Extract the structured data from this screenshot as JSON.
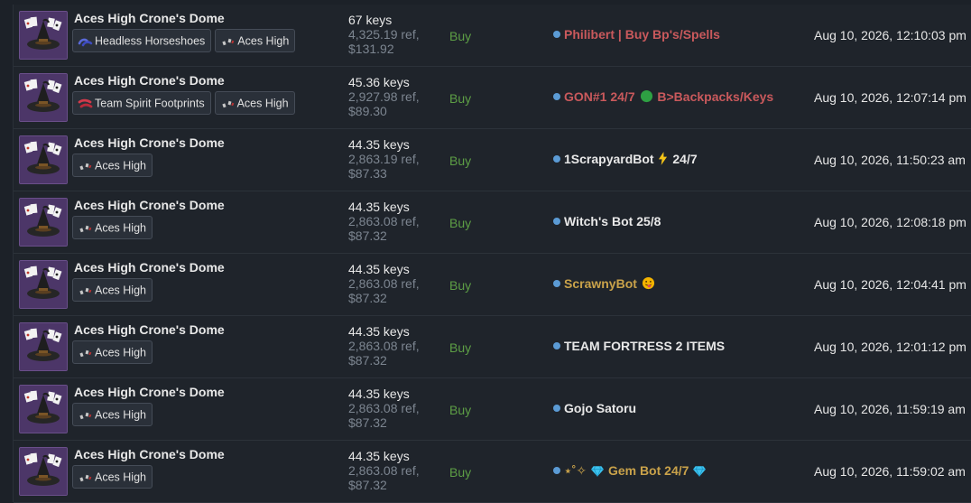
{
  "listings": [
    {
      "item": "Aces High Crone's Dome",
      "tags": [
        {
          "icon": "headless-horseshoes-icon",
          "label": "Headless Horseshoes"
        },
        {
          "icon": "aces-high-icon",
          "label": "Aces High"
        }
      ],
      "keys": "67 keys",
      "ref": "4,325.19 ref,",
      "usd": "$131.92",
      "intent": "Buy",
      "seller": {
        "pre": "Philibert | Buy Bp's/Spells",
        "emoji": "",
        "post": "",
        "color": "#c9595c"
      },
      "time": "Aug 10, 2026, 12:10:03 pm"
    },
    {
      "item": "Aces High Crone's Dome",
      "tags": [
        {
          "icon": "team-spirit-footprints-icon",
          "label": "Team Spirit Footprints"
        },
        {
          "icon": "aces-high-icon",
          "label": "Aces High"
        }
      ],
      "keys": "45.36 keys",
      "ref": "2,927.98 ref,",
      "usd": "$89.30",
      "intent": "Buy",
      "seller": {
        "pre": "GON#1 24/7",
        "emoji": "green-circle-icon",
        "post": "B>Backpacks/Keys",
        "color": "#c9595c"
      },
      "time": "Aug 10, 2026, 12:07:14 pm"
    },
    {
      "item": "Aces High Crone's Dome",
      "tags": [
        {
          "icon": "aces-high-icon",
          "label": "Aces High"
        }
      ],
      "keys": "44.35 keys",
      "ref": "2,863.19 ref,",
      "usd": "$87.33",
      "intent": "Buy",
      "seller": {
        "pre": "1ScrapyardBot",
        "emoji": "lightning-icon",
        "post": "24/7",
        "color": "#e8e8e8"
      },
      "time": "Aug 10, 2026, 11:50:23 am"
    },
    {
      "item": "Aces High Crone's Dome",
      "tags": [
        {
          "icon": "aces-high-icon",
          "label": "Aces High"
        }
      ],
      "keys": "44.35 keys",
      "ref": "2,863.08 ref,",
      "usd": "$87.32",
      "intent": "Buy",
      "seller": {
        "pre": "Witch's Bot 25/8",
        "emoji": "",
        "post": "",
        "color": "#e8e8e8"
      },
      "time": "Aug 10, 2026, 12:08:18 pm"
    },
    {
      "item": "Aces High Crone's Dome",
      "tags": [
        {
          "icon": "aces-high-icon",
          "label": "Aces High"
        }
      ],
      "keys": "44.35 keys",
      "ref": "2,863.08 ref,",
      "usd": "$87.32",
      "intent": "Buy",
      "seller": {
        "pre": "ScrawnyBot",
        "emoji": "tongue-face-icon",
        "post": "",
        "color": "#c9a24a"
      },
      "time": "Aug 10, 2026, 12:04:41 pm"
    },
    {
      "item": "Aces High Crone's Dome",
      "tags": [
        {
          "icon": "aces-high-icon",
          "label": "Aces High"
        }
      ],
      "keys": "44.35 keys",
      "ref": "2,863.08 ref,",
      "usd": "$87.32",
      "intent": "Buy",
      "seller": {
        "pre": "TEAM FORTRESS 2 ITEMS",
        "emoji": "",
        "post": "",
        "color": "#e8e8e8"
      },
      "time": "Aug 10, 2026, 12:01:12 pm"
    },
    {
      "item": "Aces High Crone's Dome",
      "tags": [
        {
          "icon": "aces-high-icon",
          "label": "Aces High"
        }
      ],
      "keys": "44.35 keys",
      "ref": "2,863.08 ref,",
      "usd": "$87.32",
      "intent": "Buy",
      "seller": {
        "pre": "Gojo Satoru",
        "emoji": "",
        "post": "",
        "color": "#e8e8e8"
      },
      "time": "Aug 10, 2026, 11:59:19 am"
    },
    {
      "item": "Aces High Crone's Dome",
      "tags": [
        {
          "icon": "aces-high-icon",
          "label": "Aces High"
        }
      ],
      "keys": "44.35 keys",
      "ref": "2,863.08 ref,",
      "usd": "$87.32",
      "intent": "Buy",
      "seller": {
        "pre": "⋆˚✧",
        "emoji": "gem-icon",
        "post": "Gem Bot 24/7",
        "emoji2": "gem-icon",
        "color": "#c9a24a"
      },
      "time": "Aug 10, 2026, 11:59:02 am"
    }
  ],
  "colors": {
    "intent_buy": "#5d9e45",
    "status_dot": "#5b9bd5",
    "thumb_bg": "#4c3668"
  }
}
